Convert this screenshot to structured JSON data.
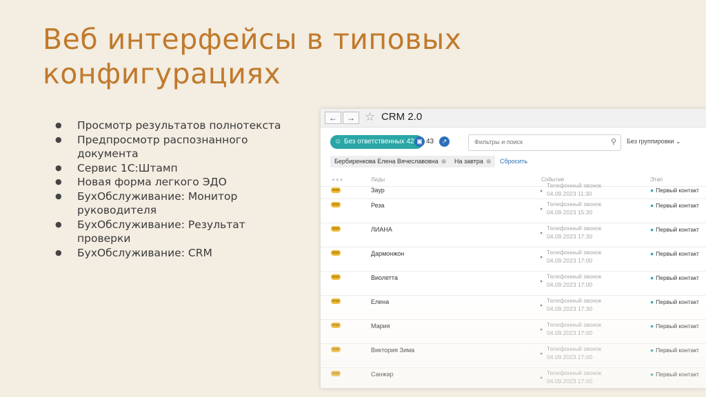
{
  "title": {
    "line1": "Веб интерфейсы в типовых",
    "line2": "конфигурациях"
  },
  "bullets": [
    "Просмотр результатов полнотекста",
    "Предпросмотр распознанного документа",
    "Сервис 1С:Штамп",
    "Новая форма легкого ЭДО",
    "БухОбслуживание: Монитор руководителя",
    "БухОбслуживание: Результат проверки",
    "БухОбслуживание: CRM"
  ],
  "screenshot": {
    "nav_back_icon": "arrow-left",
    "nav_forward_icon": "arrow-right",
    "star_icon": "star-outline",
    "app_title": "CRM 2.0",
    "toolbar": {
      "filter_pill": "Без ответственных 428",
      "count": "43",
      "search_placeholder": "Фильтры и поиск",
      "grouping": "Без группировки ⌄"
    },
    "chips": [
      "Бербиренкова Елена Вячеславовна",
      "На завтра"
    ],
    "reset_label": "Сбросить",
    "columns": [
      "Лиды",
      "Событие",
      "Этап"
    ],
    "badge_text": "lead",
    "accent_color": "#2aa6a6",
    "rows": [
      {
        "name": "Заур",
        "event": "Телефонный звонок",
        "date": "04.09.2023 11:30",
        "stage": "Первый контакт"
      },
      {
        "name": "Реза",
        "event": "Телефонный звонок",
        "date": "04.09.2023 15:30",
        "stage": "Первый контакт"
      },
      {
        "name": "ЛИАНА",
        "event": "Телефонный звонок",
        "date": "04.09.2023 17:30",
        "stage": "Первый контакт"
      },
      {
        "name": "Дармонжон",
        "event": "Телефонный звонок",
        "date": "04.09.2023 17:00",
        "stage": "Первый контакт"
      },
      {
        "name": "Виолетта",
        "event": "Телефонный звонок",
        "date": "04.09.2023 17:00",
        "stage": "Первый контакт"
      },
      {
        "name": "Елена",
        "event": "Телефонный звонок",
        "date": "04.09.2023 17:30",
        "stage": "Первый контакт"
      },
      {
        "name": "Мария",
        "event": "Телефонный звонок",
        "date": "04.09.2023 17:00",
        "stage": "Первый контакт"
      },
      {
        "name": "Виктория Зима",
        "event": "Телефонный звонок",
        "date": "04.09.2023 17:00",
        "stage": "Первый контакт"
      },
      {
        "name": "Санжар",
        "event": "Телефонный звонок",
        "date": "04.09.2023 17:00",
        "stage": "Первый контакт"
      }
    ]
  }
}
